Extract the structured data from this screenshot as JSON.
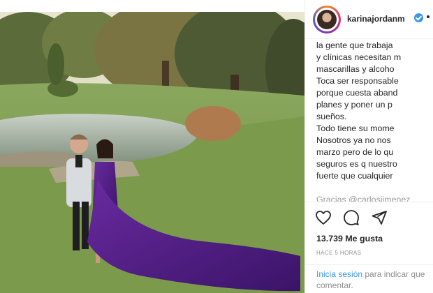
{
  "post": {
    "username": "karinajordanm",
    "caption_lines": [
      "la gente que trabaja",
      "y clínicas necesitan m",
      "mascarillas y alcoho",
      "Toca ser responsable",
      "porque cuesta aband",
      "planes y poner un p",
      "sueños.",
      "Todo tiene su mome",
      "Nosotros ya no nos",
      "marzo pero de lo qu",
      "seguros es q nuestro",
      "fuerte que cualquier",
      "",
      "Gracias @carlosjimenez"
    ],
    "likes_text": "13.739 Me gusta",
    "time_text": "HACE 5 HORAS",
    "login_link": "Inicia sesión",
    "login_rest": " para indicar que",
    "login_line2": "comentar."
  },
  "icons": {
    "avatar": "profile-avatar",
    "verified": "verified-badge-icon",
    "like": "heart-icon",
    "comment": "comment-bubble-icon",
    "share": "paper-plane-icon"
  },
  "colors": {
    "link": "#3897f0",
    "text": "#262626",
    "muted": "#8e8e8e",
    "border": "#efefef"
  }
}
